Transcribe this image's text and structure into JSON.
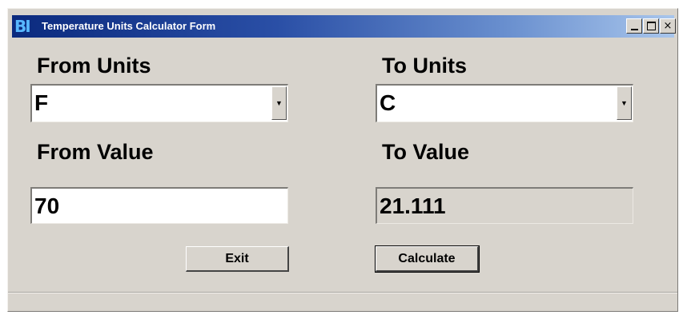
{
  "window": {
    "title": "Temperature Units Calculator Form",
    "logo": "BI",
    "controls": {
      "minimize": "minimize-icon",
      "maximize": "maximize-icon",
      "close": "close-icon",
      "close_glyph": "×"
    }
  },
  "form": {
    "from_units_label": "From Units",
    "to_units_label": "To Units",
    "from_units_value": "F",
    "to_units_value": "C",
    "from_value_label": "From Value",
    "to_value_label": "To Value",
    "from_value": "70",
    "to_value": "21.111",
    "dropdown_glyph": "▼"
  },
  "buttons": {
    "exit_label": "Exit",
    "calculate_label": "Calculate"
  },
  "colors": {
    "window_bg": "#d8d4cd",
    "titlebar_start": "#0b2a7e",
    "titlebar_end": "#a9c6ec"
  }
}
